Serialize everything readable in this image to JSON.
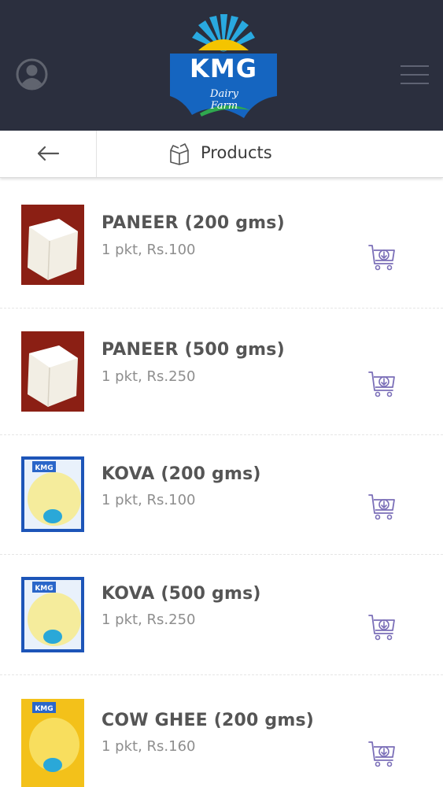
{
  "header": {
    "logo_brand": "KMG",
    "logo_sub_line1": "Dairy",
    "logo_sub_line2": "Farm",
    "colors": {
      "bar": "#2b2f3e",
      "logo_blue": "#1565c0",
      "sun_blue": "#29a9e0"
    }
  },
  "titlebar": {
    "title": "Products",
    "back_icon": "arrow-left-icon",
    "title_icon": "box-icon"
  },
  "products": [
    {
      "name": "PANEER (200 gms)",
      "detail": "1 pkt, Rs.100",
      "image": "paneer"
    },
    {
      "name": "PANEER (500 gms)",
      "detail": "1 pkt, Rs.250",
      "image": "paneer"
    },
    {
      "name": "KOVA (200 gms)",
      "detail": "1 pkt, Rs.100",
      "image": "kova"
    },
    {
      "name": "KOVA (500 gms)",
      "detail": "1 pkt, Rs.250",
      "image": "kova"
    },
    {
      "name": "COW GHEE (200 gms)",
      "detail": "1 pkt, Rs.160",
      "image": "ghee"
    }
  ],
  "icons": {
    "cart": "add-to-cart-icon",
    "accent": "#7b6fb8"
  }
}
